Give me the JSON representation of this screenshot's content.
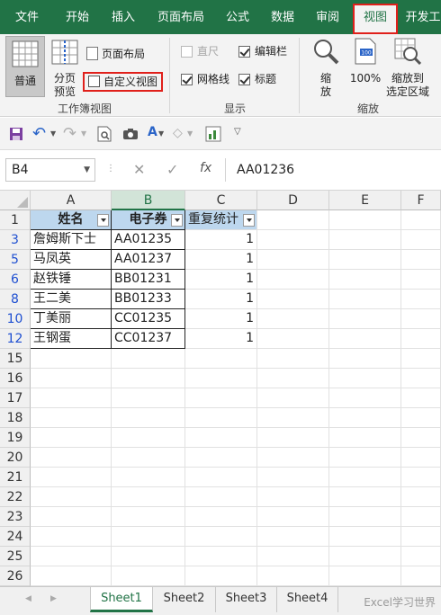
{
  "ribbon_tabs": [
    "文件",
    "开始",
    "插入",
    "页面布局",
    "公式",
    "数据",
    "审阅",
    "视图",
    "开发工"
  ],
  "active_tab": "视图",
  "ribbon": {
    "normal_label": "普通",
    "page_break_label": "分页",
    "page_break_label2": "预览",
    "page_layout_label": "页面布局",
    "custom_views_label": "自定义视图",
    "group1_label": "工作簿视图",
    "ruler_label": "直尺",
    "formula_bar_label": "编辑栏",
    "gridlines_label": "网格线",
    "headings_label": "标题",
    "group2_label": "显示",
    "zoom_label": "缩",
    "zoom_label2": "放",
    "zoom100_label": "100%",
    "zoom_sel_label": "缩放到",
    "zoom_sel_label2": "选定区域",
    "group3_label": "缩放",
    "checks": {
      "ruler": false,
      "formula_bar": true,
      "gridlines": true,
      "headings": true
    }
  },
  "formula_bar": {
    "name_box": "B4",
    "formula": "AA01236",
    "fx": "fx"
  },
  "columns": [
    "A",
    "B",
    "C",
    "D",
    "E",
    "F"
  ],
  "table_header": [
    "姓名",
    "电子券",
    "重复统计"
  ],
  "rows": [
    {
      "num": "1"
    },
    {
      "num": "3",
      "a": "詹姆斯下士",
      "b": "AA01235",
      "c": "1"
    },
    {
      "num": "5",
      "a": "马凤英",
      "b": "AA01237",
      "c": "1"
    },
    {
      "num": "6",
      "a": "赵铁锤",
      "b": "BB01231",
      "c": "1"
    },
    {
      "num": "8",
      "a": "王二美",
      "b": "BB01233",
      "c": "1"
    },
    {
      "num": "10",
      "a": "丁美丽",
      "b": "CC01235",
      "c": "1"
    },
    {
      "num": "12",
      "a": "王钢蛋",
      "b": "CC01237",
      "c": "1"
    },
    {
      "num": "15"
    },
    {
      "num": "16"
    },
    {
      "num": "17"
    },
    {
      "num": "18"
    },
    {
      "num": "19"
    },
    {
      "num": "20"
    },
    {
      "num": "21"
    },
    {
      "num": "22"
    },
    {
      "num": "23"
    },
    {
      "num": "24"
    },
    {
      "num": "25"
    },
    {
      "num": "26"
    }
  ],
  "sheets": [
    "Sheet1",
    "Sheet2",
    "Sheet3",
    "Sheet4"
  ],
  "active_sheet": "Sheet1",
  "watermark": "Excel学习世界",
  "colors": {
    "excel_green": "#217346",
    "header_fill": "#bdd7ee",
    "highlight": "#e0201b"
  }
}
